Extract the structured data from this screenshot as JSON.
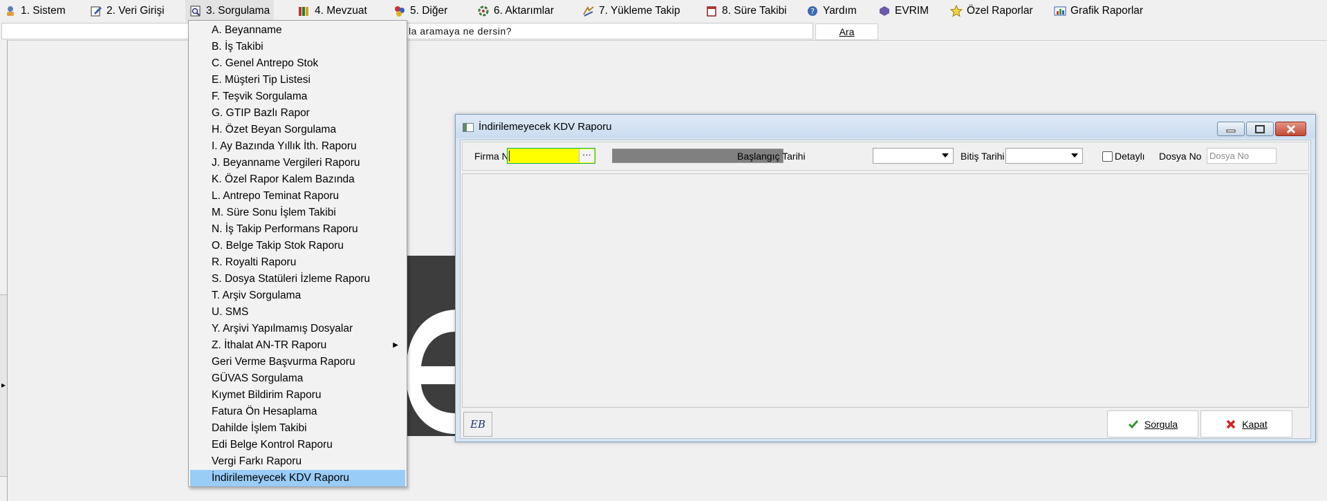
{
  "menubar": {
    "items": [
      {
        "label": "1.   Sistem",
        "icon": "system-icon"
      },
      {
        "label": "2.   Veri Girişi",
        "icon": "data-entry-icon"
      },
      {
        "label": "3.   Sorgulama",
        "icon": "query-icon"
      },
      {
        "label": "4.   Mevzuat",
        "icon": "legislation-icon"
      },
      {
        "label": "5.   Diğer",
        "icon": "other-icon"
      },
      {
        "label": "6.   Aktarımlar",
        "icon": "transfer-icon"
      },
      {
        "label": "7.   Yükleme Takip",
        "icon": "upload-tracking-icon"
      },
      {
        "label": "8. Süre Takibi",
        "icon": "calendar-icon"
      },
      {
        "label": "Yardım",
        "icon": "help-icon"
      },
      {
        "label": "EVRIM",
        "icon": "evrim-icon"
      },
      {
        "label": "Özel Raporlar",
        "icon": "star-icon"
      },
      {
        "label": "Grafik Raporlar",
        "icon": "chart-icon"
      }
    ]
  },
  "search": {
    "placeholder": "la aramaya ne dersin?",
    "button_label": "Ara"
  },
  "dropdown": {
    "items": [
      {
        "label": "A.  Beyanname"
      },
      {
        "label": "B.  İş Takibi"
      },
      {
        "label": "C.  Genel Antrepo Stok"
      },
      {
        "label": "E.  Müşteri Tip Listesi"
      },
      {
        "label": "F.  Teşvik Sorgulama"
      },
      {
        "label": "G.  GTIP Bazlı Rapor"
      },
      {
        "label": "H.  Özet Beyan Sorgulama"
      },
      {
        "label": "I.   Ay Bazında Yıllık İth. Raporu"
      },
      {
        "label": "J.   Beyanname Vergileri Raporu"
      },
      {
        "label": "K. Özel Rapor Kalem Bazında"
      },
      {
        "label": "L.  Antrepo Teminat Raporu"
      },
      {
        "label": "M.  Süre Sonu İşlem Takibi"
      },
      {
        "label": "N.  İş Takip Performans Raporu"
      },
      {
        "label": "O.  Belge Takip Stok Raporu"
      },
      {
        "label": "R.  Royalti Raporu"
      },
      {
        "label": "S.   Dosya Statüleri İzleme Raporu"
      },
      {
        "label": "T.   Arşiv Sorgulama"
      },
      {
        "label": "U.  SMS"
      },
      {
        "label": "Y.  Arşivi Yapılmamış Dosyalar"
      },
      {
        "label": "Z.  İthalat AN-TR Raporu",
        "submenu": true
      },
      {
        "label": "Geri Verme Başvurma Raporu"
      },
      {
        "label": "GÜVAS Sorgulama"
      },
      {
        "label": "Kıymet Bildirim Raporu"
      },
      {
        "label": "Fatura Ön Hesaplama"
      },
      {
        "label": "Dahilde İşlem Takibi"
      },
      {
        "label": "Edi Belge Kontrol Raporu"
      },
      {
        "label": "Vergi Farkı Raporu"
      },
      {
        "label": "İndirilemeyecek KDV Raporu",
        "selected": true
      }
    ],
    "selected_color": "#99ccf7"
  },
  "report_window": {
    "title": "İndirilemeyecek KDV Raporu",
    "filters": {
      "firma_no_label": "Firma No",
      "firma_no_value": "",
      "lookup_label": "···",
      "start_date_label": "Başlangıç Tarihi",
      "end_date_label": "Bitiş Tarihi",
      "detayli_label": "Detaylı",
      "detayli_checked": false,
      "dosya_no_label": "Dosya No",
      "dosya_no_placeholder": "Dosya No"
    },
    "buttons": {
      "eb_label": "EB",
      "query_label": "Sorgula",
      "close_label": "Kapat"
    },
    "colors": {
      "firma_field": "#ffff00",
      "firma_name_field": "#808080"
    }
  }
}
